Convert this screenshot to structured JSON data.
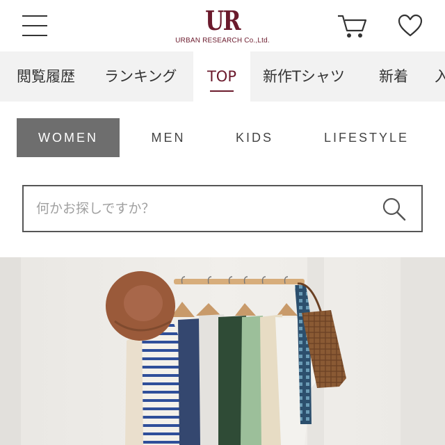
{
  "header": {
    "logo_mark": "UR",
    "logo_sub": "URBAN RESEARCH Co.,Ltd.",
    "menu_icon": "hamburger-menu-icon",
    "cart_icon": "cart-icon",
    "favorite_icon": "heart-icon"
  },
  "category_nav": {
    "items": [
      {
        "label": "閲覧履歴"
      },
      {
        "label": "ランキング"
      },
      {
        "label": "TOP",
        "active": true
      },
      {
        "label": "新作Tシャツ"
      },
      {
        "label": "新着"
      },
      {
        "label": "入"
      }
    ]
  },
  "gender_tabs": {
    "items": [
      {
        "label": "WOMEN",
        "active": true
      },
      {
        "label": "MEN"
      },
      {
        "label": "KIDS"
      },
      {
        "label": "LIFESTYLE"
      }
    ]
  },
  "search": {
    "placeholder": "何かお探しですか？",
    "value": "",
    "icon": "search-icon"
  },
  "colors": {
    "brand": "#6b1a2c",
    "nav_bg": "#f2f2f2",
    "active_tab_bg": "#6e6e6e"
  }
}
